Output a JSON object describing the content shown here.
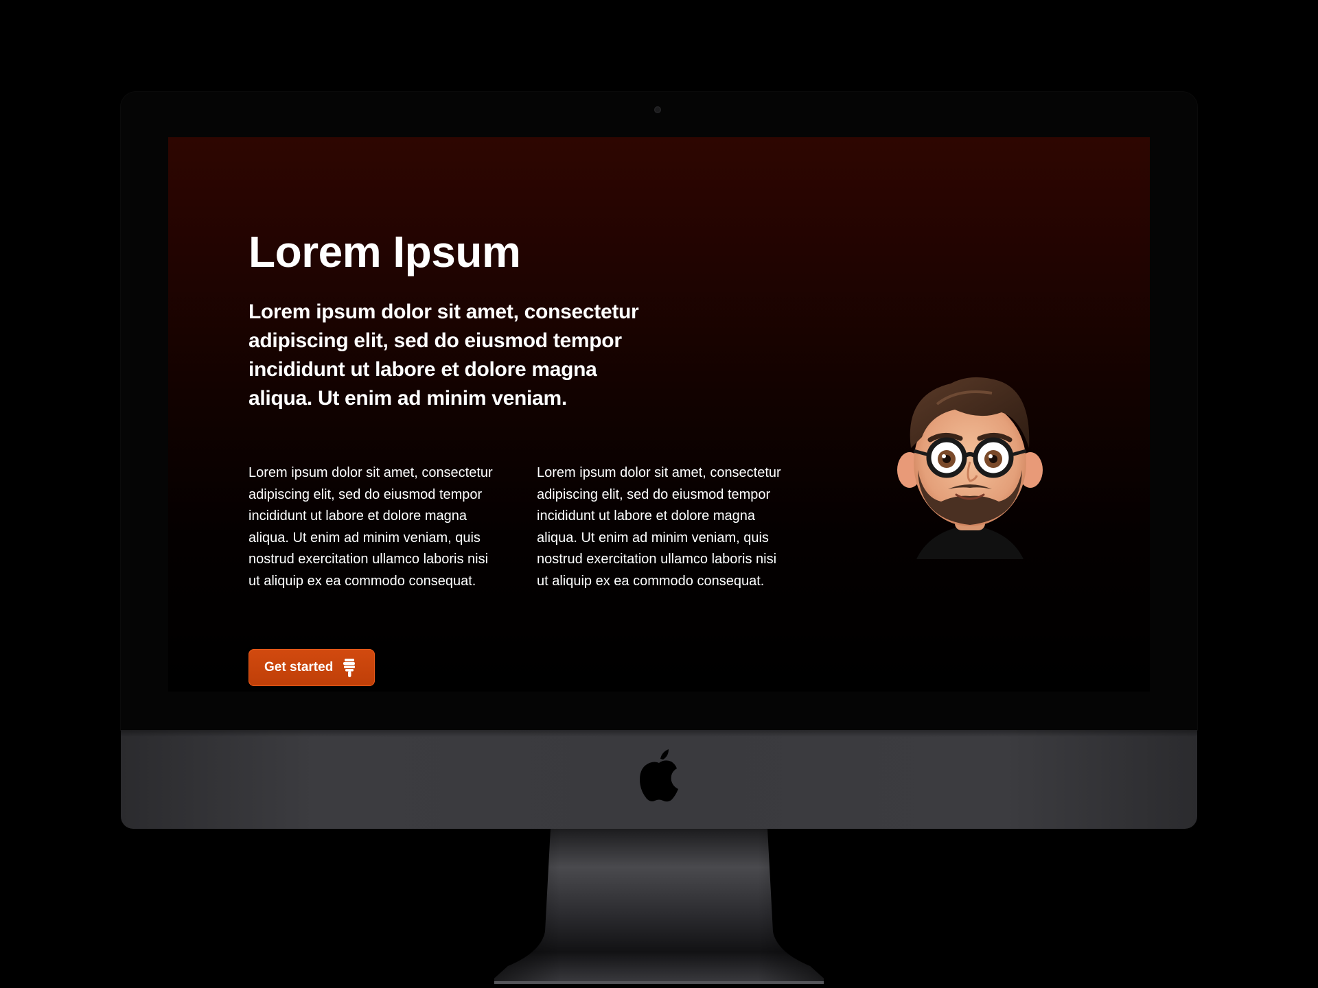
{
  "hero": {
    "title": "Lorem Ipsum",
    "subtitle": "Lorem ipsum dolor sit amet, consectetur adipiscing elit, sed do eiusmod tempor incididunt ut labore et dolore magna aliqua. Ut enim ad minim veniam.",
    "columns": [
      "Lorem ipsum dolor sit amet, consectetur adipiscing elit, sed do eiusmod tempor incididunt ut labore et dolore magna aliqua. Ut enim ad minim veniam, quis nostrud exercitation ullamco laboris nisi ut aliquip ex ea commodo consequat.",
      "Lorem ipsum dolor sit amet, consectetur adipiscing elit, sed do eiusmod tempor incididunt ut labore et dolore magna aliqua. Ut enim ad minim veniam, quis nostrud exercitation ullamco laboris nisi ut aliquip ex ea commodo consequat."
    ],
    "cta_label": "Get started",
    "cta_icon": "thumb-down-icon"
  },
  "avatar": {
    "icon": "memoji-avatar"
  },
  "device": {
    "logo_icon": "apple-logo-icon"
  },
  "colors": {
    "accent": "#c8440b",
    "screen_top": "#2e0601",
    "screen_bottom": "#000000",
    "chin": "#3a3a3e"
  }
}
